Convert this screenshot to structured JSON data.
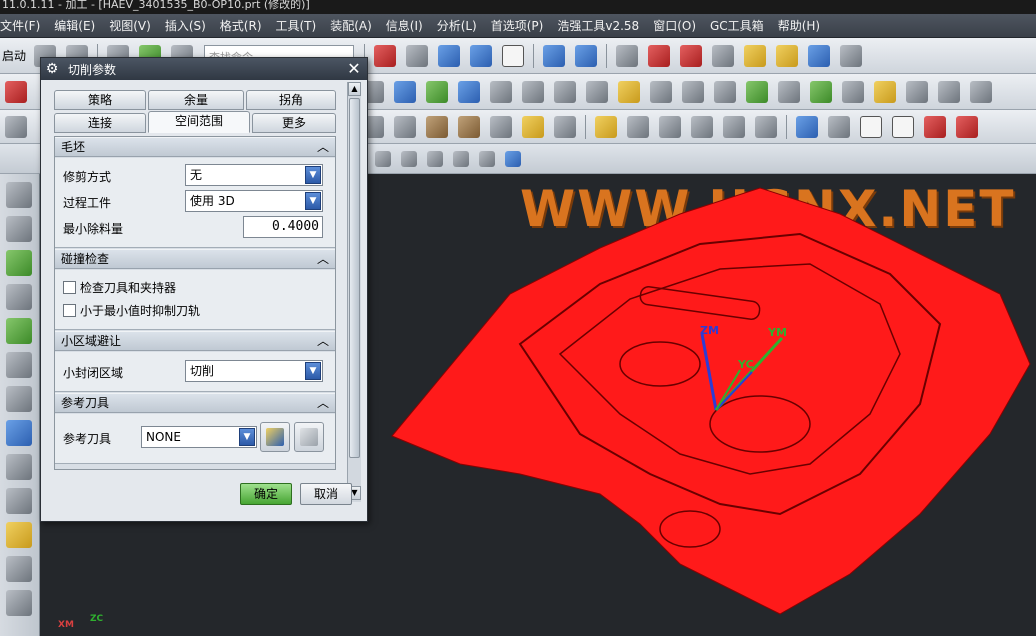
{
  "window": {
    "title": "11.0.1.11 - 加工 - [HAEV_3401535_B0-OP10.prt (修改的)]"
  },
  "menubar": {
    "items": [
      "文件(F)",
      "编辑(E)",
      "视图(V)",
      "插入(S)",
      "格式(R)",
      "工具(T)",
      "装配(A)",
      "信息(I)",
      "分析(L)",
      "首选项(P)",
      "浩强工具v2.58",
      "窗口(O)",
      "GC工具箱",
      "帮助(H)"
    ]
  },
  "toolbar": {
    "start_label": "启动",
    "search_placeholder": "查找命令"
  },
  "viewport": {
    "watermark": "WWW.UGNX.NET",
    "axis_labels": {
      "zm": "ZM",
      "ym": "YM",
      "yc": "YC",
      "xm": "XM",
      "zc": "ZC"
    },
    "part_color": "#ff1a1a"
  },
  "dialog": {
    "title": "切削参数",
    "tabs_row1": [
      "策略",
      "余量",
      "拐角"
    ],
    "tabs_row2": [
      "连接",
      "空间范围",
      "更多"
    ],
    "active_tab": "空间范围",
    "groups": {
      "blank": {
        "header": "毛坯",
        "trim_label": "修剪方式",
        "trim_value": "无",
        "ipw_label": "过程工件",
        "ipw_value": "使用 3D",
        "min_removal_label": "最小除料量",
        "min_removal_value": "0.4000"
      },
      "collision": {
        "header": "碰撞检查",
        "check_holder_label": "检查刀具和夹持器",
        "suppress_label": "小于最小值时抑制刀轨"
      },
      "small_area": {
        "header": "小区域避让",
        "closed_area_label": "小封闭区域",
        "closed_area_value": "切削"
      },
      "ref_tool": {
        "header": "参考刀具",
        "ref_tool_label": "参考刀具",
        "ref_tool_value": "NONE"
      }
    },
    "ok_label": "确定",
    "cancel_label": "取消"
  }
}
